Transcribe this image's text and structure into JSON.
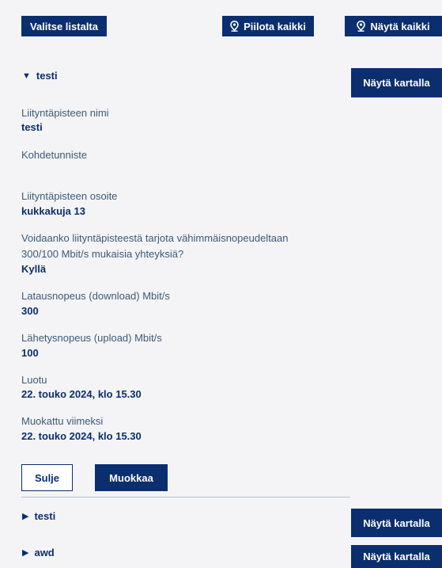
{
  "toolbar": {
    "select_from_list": "Valitse listalta",
    "hide_all": "Piilota kaikki",
    "show_all": "Näytä kaikki"
  },
  "items": [
    {
      "title": "testi",
      "expanded": true,
      "show_on_map": "Näytä kartalla",
      "fields": {
        "name_label": "Liityntäpisteen nimi",
        "name_value": "testi",
        "target_id_label": "Kohdetunniste",
        "target_id_value": "",
        "address_label": "Liityntäpisteen osoite",
        "address_value": "kukkakuja 13",
        "min_speed_label_line1": "Voidaanko liityntäpisteestä tarjota vähimmäisnopeudeltaan",
        "min_speed_label_line2": "300/100 Mbit/s mukaisia yhteyksiä?",
        "min_speed_value": "Kyllä",
        "download_label": "Latausnopeus (download) Mbit/s",
        "download_value": "300",
        "upload_label": "Lähetysnopeus (upload) Mbit/s",
        "upload_value": "100",
        "created_label": "Luotu",
        "created_value": "22. touko 2024, klo 15.30",
        "modified_label": "Muokattu viimeksi",
        "modified_value": "22. touko 2024, klo 15.30"
      },
      "close_button": "Sulje",
      "edit_button": "Muokkaa"
    },
    {
      "title": "testi",
      "expanded": false,
      "show_on_map": "Näytä kartalla"
    },
    {
      "title": "awd",
      "expanded": false,
      "show_on_map": "Näytä kartalla"
    }
  ],
  "icons": {
    "expanded": "triangle-down-icon",
    "collapsed": "triangle-right-icon",
    "location": "location-pin-icon"
  },
  "colors": {
    "primary": "#0b2e6f",
    "background": "#f4f4f6",
    "label": "#3b5a78"
  }
}
